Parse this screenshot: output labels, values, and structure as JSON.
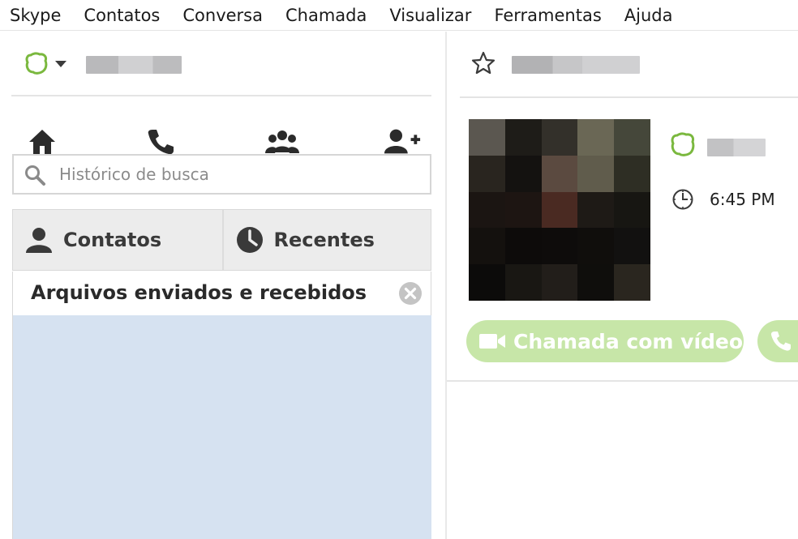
{
  "menu": {
    "items": [
      "Skype",
      "Contatos",
      "Conversa",
      "Chamada",
      "Visualizar",
      "Ferramentas",
      "Ajuda"
    ]
  },
  "profile": {
    "status_icon": "skype-status-icon",
    "status_color": "#7ab83e"
  },
  "nav": {
    "icons": [
      "home-icon",
      "phone-icon",
      "group-icon",
      "add-contact-icon"
    ]
  },
  "search": {
    "placeholder": "Histórico de busca",
    "value": ""
  },
  "tabs": [
    {
      "label": "Contatos",
      "icon": "person-icon"
    },
    {
      "label": "Recentes",
      "icon": "clock-icon"
    }
  ],
  "section": {
    "title": "Arquivos enviados e recebidos"
  },
  "contact": {
    "local_time": "6:45 PM",
    "video_call_label": "Chamada com vídeo"
  },
  "colors": {
    "accent_green": "#c7e6a8",
    "list_bg": "#d6e2f1",
    "skype_green": "#7ab83e"
  }
}
